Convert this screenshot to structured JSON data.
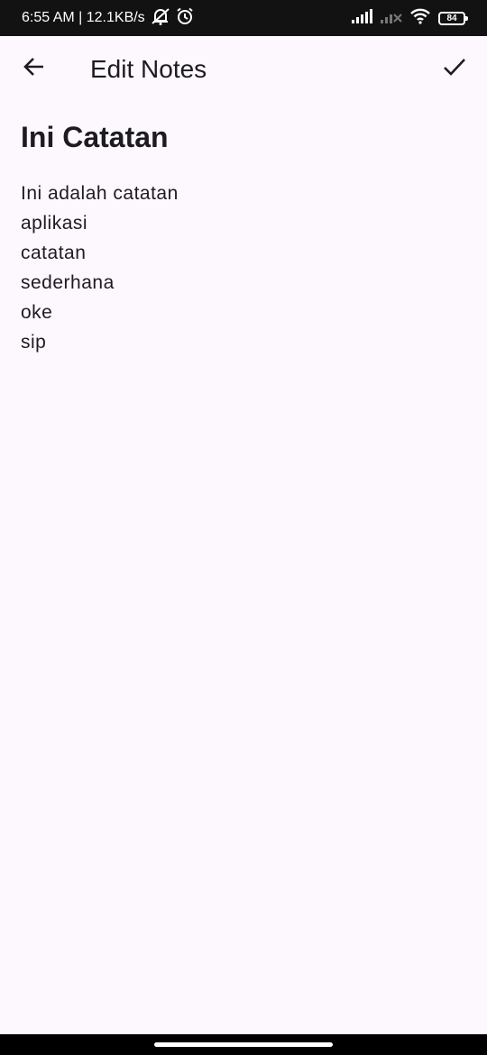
{
  "status_bar": {
    "time": "6:55 AM | 12.1KB/s",
    "battery_level": "84",
    "icons": [
      "mute-bell-icon",
      "alarm-icon",
      "signal-icon",
      "signal-no-sim-icon",
      "wifi-icon",
      "battery-icon"
    ]
  },
  "app_bar": {
    "title": "Edit Notes",
    "back_icon": "arrow-back-icon",
    "save_icon": "check-icon"
  },
  "note": {
    "title": "Ini Catatan",
    "lines": [
      "Ini adalah catatan",
      "aplikasi",
      "catatan",
      "sederhana",
      "oke",
      "sip"
    ]
  },
  "colors": {
    "background": "#fdf7fe",
    "status_bar": "#121212",
    "text": "#1d1b20"
  }
}
